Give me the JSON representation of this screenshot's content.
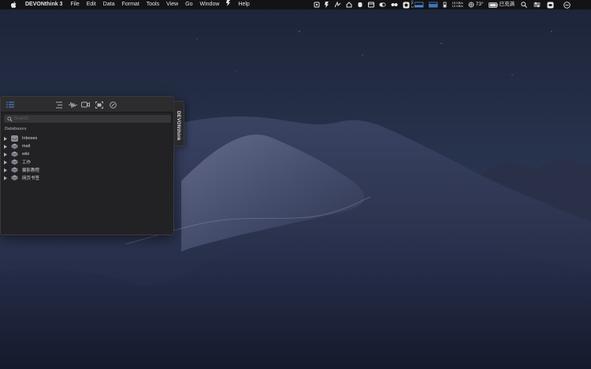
{
  "menubar": {
    "app_name": "DEVONthink 3",
    "items": [
      "File",
      "Edit",
      "Data",
      "Format",
      "Tools",
      "View",
      "Go",
      "Window",
      "Help"
    ],
    "network": {
      "up": "15 KB/s",
      "down": "10 KB/s"
    },
    "temperature": "73°",
    "battery_status": "已充满",
    "icons": [
      "apple-logo",
      "script-menu",
      "hourglass",
      "screen-rotate",
      "cloud",
      "home",
      "toggle",
      "dots",
      "settings-gear",
      "cpu-monitor",
      "search",
      "control-center",
      "siri",
      "notification-center"
    ]
  },
  "sorter": {
    "search": {
      "placeholder": "Search",
      "value": ""
    },
    "section_label": "Databases",
    "databases": [
      {
        "label": "Inboxes",
        "icon": "inbox-tray-icon"
      },
      {
        "label": "mail",
        "icon": "database-icon"
      },
      {
        "label": "wiki",
        "icon": "database-icon"
      },
      {
        "label": "工作",
        "icon": "database-icon"
      },
      {
        "label": "摄影教程",
        "icon": "database-icon"
      },
      {
        "label": "网页书签",
        "icon": "database-icon"
      }
    ],
    "toolbar_icons": [
      "list-view-icon",
      "sorting-icon",
      "audio-icon",
      "video-icon",
      "capture-area-icon",
      "compass-icon"
    ],
    "tab_label": "DEVONthink"
  },
  "colors": {
    "accent": "#4a90e2",
    "panel_bg": "#222225",
    "menubar_bg": "#131316"
  }
}
